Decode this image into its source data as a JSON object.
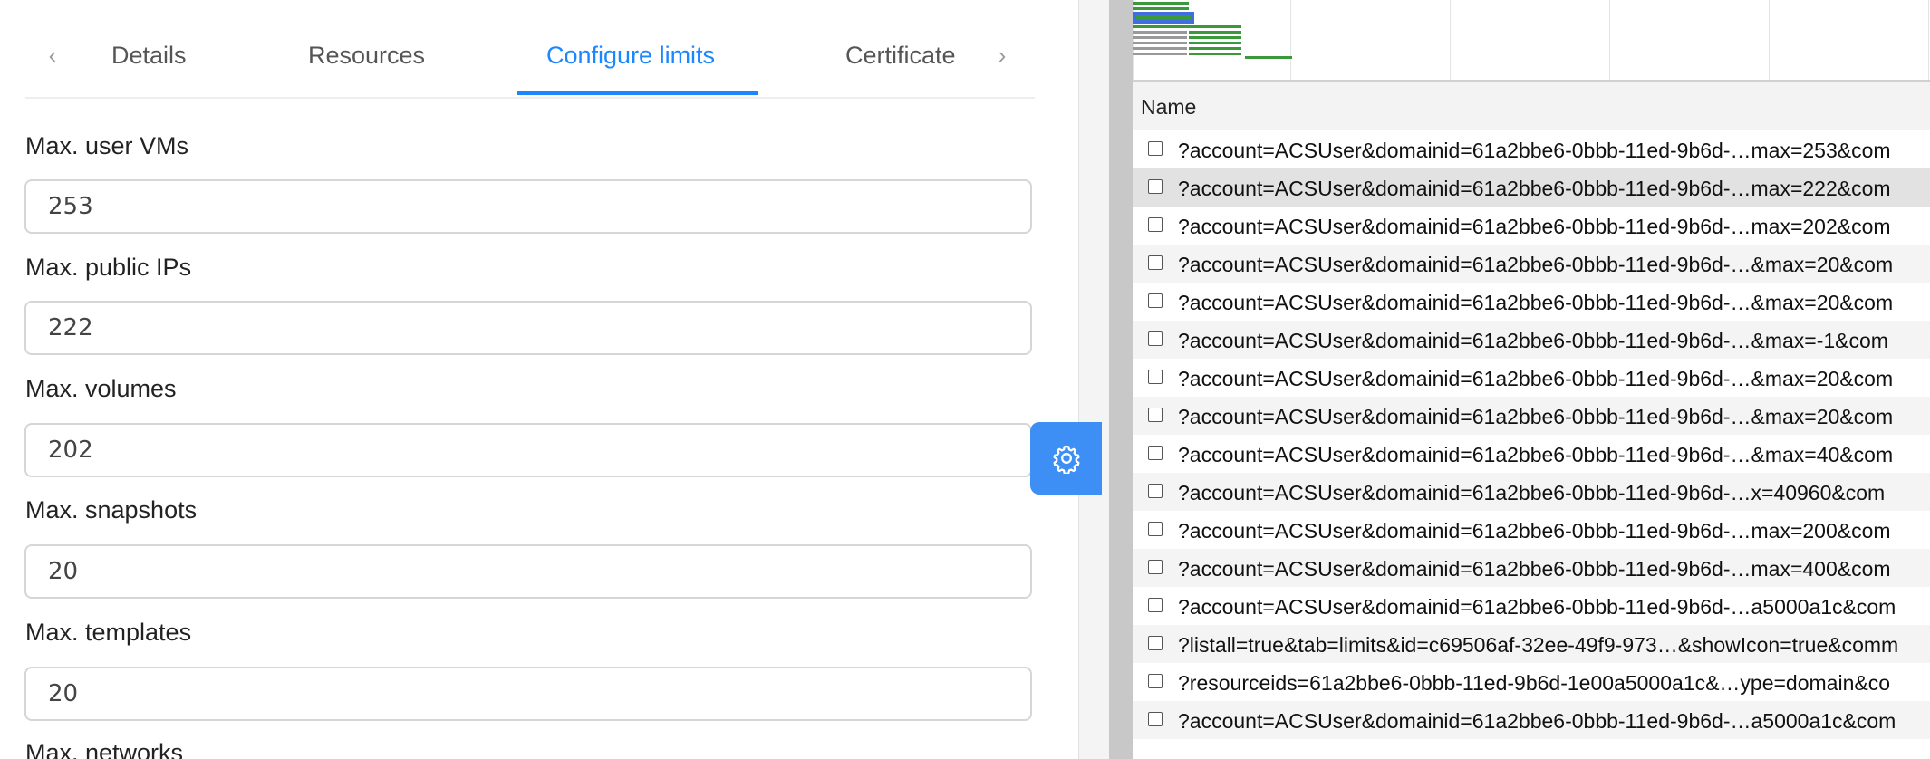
{
  "tabs": {
    "prev_icon": "chevron-left-icon",
    "next_icon": "chevron-right-icon",
    "items": [
      {
        "label": "Details"
      },
      {
        "label": "Resources"
      },
      {
        "label": "Configure limits",
        "active": true
      },
      {
        "label": "Certificate"
      }
    ]
  },
  "fields": [
    {
      "label": "Max. user VMs",
      "value": "253"
    },
    {
      "label": "Max. public IPs",
      "value": "222"
    },
    {
      "label": "Max. volumes",
      "value": "202"
    },
    {
      "label": "Max. snapshots",
      "value": "20"
    },
    {
      "label": "Max. templates",
      "value": "20"
    },
    {
      "label": "Max. networks"
    }
  ],
  "settings_button": {
    "icon": "gear-icon"
  },
  "colors": {
    "accent": "#1a86ff",
    "button": "#3d8ff5",
    "waterfall_green": "#3a9a3a",
    "waterfall_blue": "#3d6fe0"
  },
  "network": {
    "column_header": "Name",
    "rows": [
      {
        "name": "?account=ACSUser&domainid=61a2bbe6-0bbb-11ed-9b6d-…max=253&com"
      },
      {
        "name": "?account=ACSUser&domainid=61a2bbe6-0bbb-11ed-9b6d-…max=222&com"
      },
      {
        "name": "?account=ACSUser&domainid=61a2bbe6-0bbb-11ed-9b6d-…max=202&com"
      },
      {
        "name": "?account=ACSUser&domainid=61a2bbe6-0bbb-11ed-9b6d-…&max=20&com"
      },
      {
        "name": "?account=ACSUser&domainid=61a2bbe6-0bbb-11ed-9b6d-…&max=20&com"
      },
      {
        "name": "?account=ACSUser&domainid=61a2bbe6-0bbb-11ed-9b6d-…&max=-1&com"
      },
      {
        "name": "?account=ACSUser&domainid=61a2bbe6-0bbb-11ed-9b6d-…&max=20&com"
      },
      {
        "name": "?account=ACSUser&domainid=61a2bbe6-0bbb-11ed-9b6d-…&max=20&com"
      },
      {
        "name": "?account=ACSUser&domainid=61a2bbe6-0bbb-11ed-9b6d-…&max=40&com"
      },
      {
        "name": "?account=ACSUser&domainid=61a2bbe6-0bbb-11ed-9b6d-…x=40960&com"
      },
      {
        "name": "?account=ACSUser&domainid=61a2bbe6-0bbb-11ed-9b6d-…max=200&com"
      },
      {
        "name": "?account=ACSUser&domainid=61a2bbe6-0bbb-11ed-9b6d-…max=400&com"
      },
      {
        "name": "?account=ACSUser&domainid=61a2bbe6-0bbb-11ed-9b6d-…a5000a1c&com"
      },
      {
        "name": "?listall=true&tab=limits&id=c69506af-32ee-49f9-973…&showIcon=true&comm"
      },
      {
        "name": "?resourceids=61a2bbe6-0bbb-11ed-9b6d-1e00a5000a1c&…ype=domain&co"
      },
      {
        "name": "?account=ACSUser&domainid=61a2bbe6-0bbb-11ed-9b6d-…a5000a1c&com"
      }
    ]
  }
}
